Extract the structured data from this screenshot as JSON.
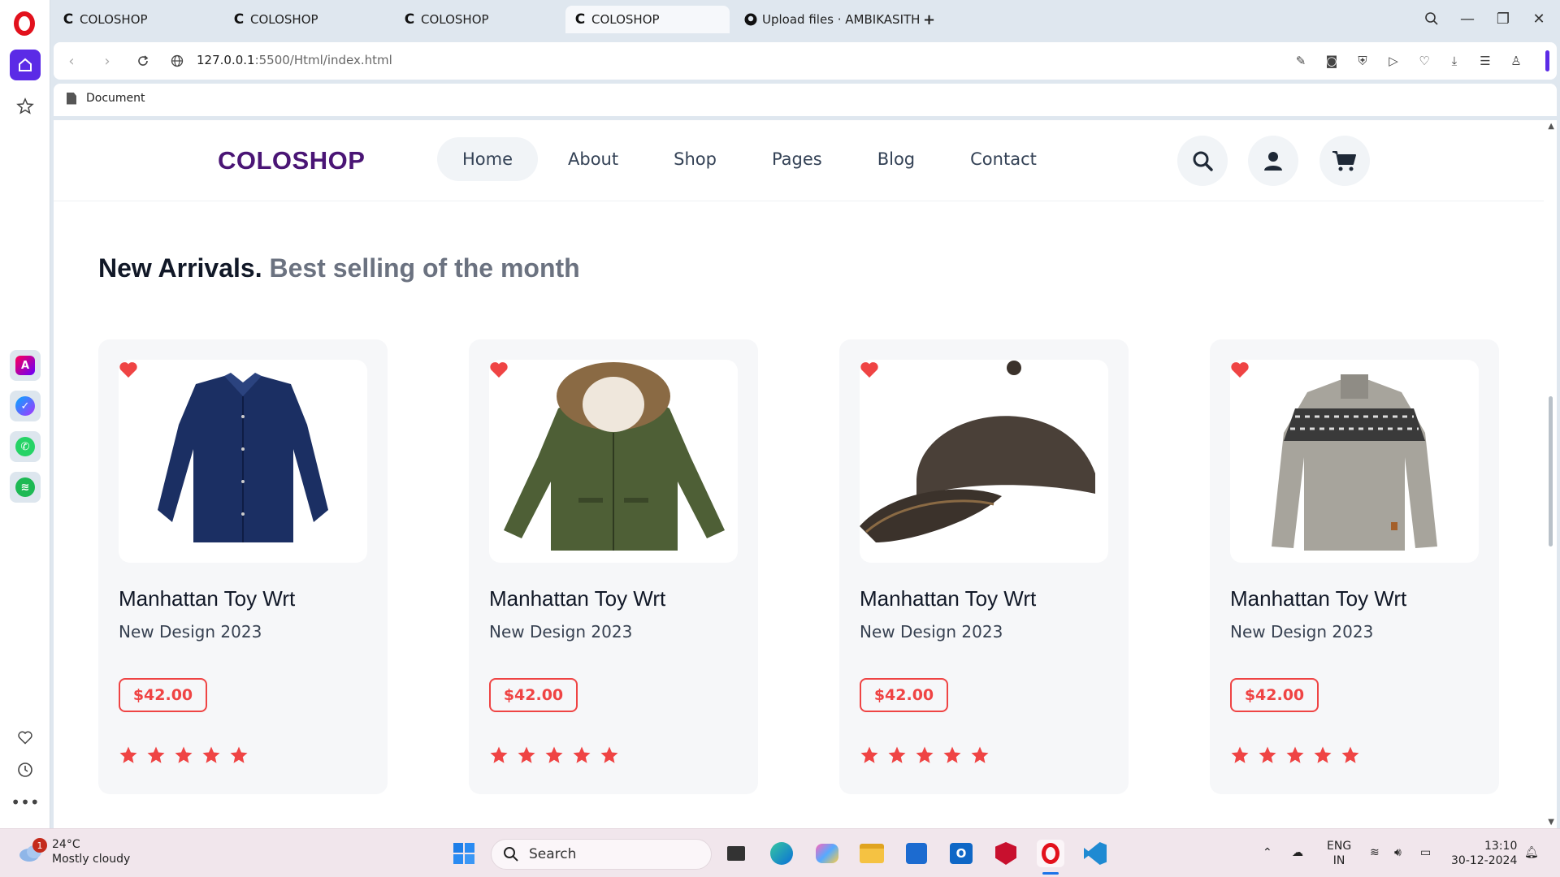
{
  "browser": {
    "tabs": [
      {
        "title": "COLOSHOP",
        "favicon": "C",
        "active": false
      },
      {
        "title": "COLOSHOP",
        "favicon": "C",
        "active": false
      },
      {
        "title": "COLOSHOP",
        "favicon": "C",
        "active": false
      },
      {
        "title": "COLOSHOP",
        "favicon": "C",
        "active": true
      },
      {
        "title": "Upload files · AMBIKASITH",
        "favicon": "github",
        "active": false
      }
    ],
    "new_tab": "+",
    "url_host": "127.0.0.1",
    "url_path": ":5500/Html/index.html",
    "bookmark": "Document"
  },
  "site": {
    "brand": "COLOSHOP",
    "nav": [
      "Home",
      "About",
      "Shop",
      "Pages",
      "Blog",
      "Contact"
    ],
    "active_nav": "Home",
    "section_title_strong": "New Arrivals.",
    "section_title_muted": " Best selling of the month",
    "products": [
      {
        "name": "Manhattan Toy Wrt",
        "subtitle": "New Design 2023",
        "price": "$42.00",
        "rating": 5,
        "image": "navy-shirt"
      },
      {
        "name": "Manhattan Toy Wrt",
        "subtitle": "New Design 2023",
        "price": "$42.00",
        "rating": 5,
        "image": "green-parka"
      },
      {
        "name": "Manhattan Toy Wrt",
        "subtitle": "New Design 2023",
        "price": "$42.00",
        "rating": 5,
        "image": "brown-cap"
      },
      {
        "name": "Manhattan Toy Wrt",
        "subtitle": "New Design 2023",
        "price": "$42.00",
        "rating": 5,
        "image": "grey-sweater"
      }
    ],
    "accent": "#ef4444",
    "brand_color": "#4a1575"
  },
  "taskbar": {
    "weather_temp": "24°C",
    "weather_desc": "Mostly cloudy",
    "weather_badge": "1",
    "search": "Search",
    "lang_line1": "ENG",
    "lang_line2": "IN",
    "time": "13:10",
    "date": "30-12-2024"
  }
}
